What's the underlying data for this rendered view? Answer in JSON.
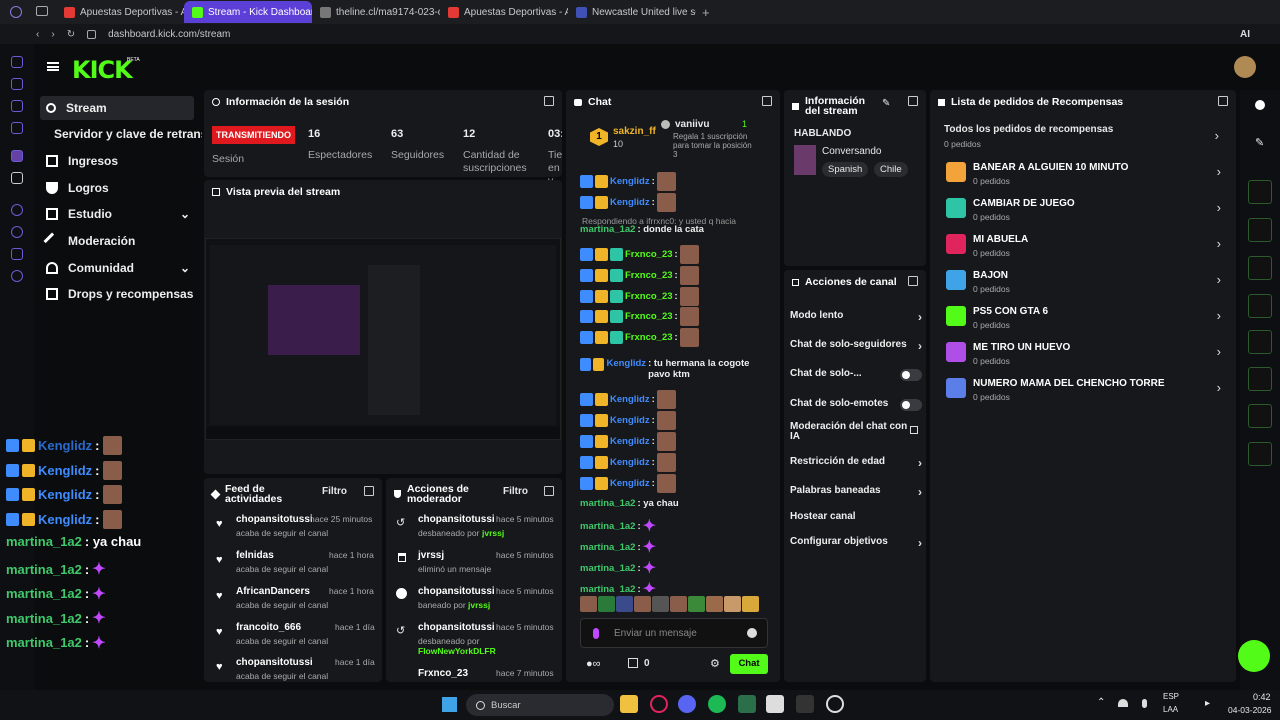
{
  "browser": {
    "tabs": [
      {
        "label": "Apuestas Deportivas - Ap",
        "color": "#e53935"
      },
      {
        "label": "Stream - Kick Dashboard",
        "color": "#53fc18"
      },
      {
        "label": "theline.cl/ma9174-023-os",
        "color": "#999999"
      },
      {
        "label": "Apuestas Deportivas - Ap",
        "color": "#e53935"
      },
      {
        "label": "Newcastle United live scor",
        "color": "#3f51b5"
      }
    ],
    "url": "dashboard.kick.com/stream",
    "ai_label": "AI"
  },
  "brand": {
    "logo": "KICK",
    "beta": "BETA",
    "accent": "#53fc18"
  },
  "nav": [
    {
      "label": "Stream",
      "icon": "broadcast-icon"
    },
    {
      "label": "Servidor y clave de retransmisión",
      "icon": ""
    },
    {
      "label": "Ingresos",
      "icon": "revenue-icon"
    },
    {
      "label": "Logros",
      "icon": "trophy-icon"
    },
    {
      "label": "Estudio",
      "icon": "studio-icon"
    },
    {
      "label": "Moderación",
      "icon": "wrench-icon"
    },
    {
      "label": "Comunidad",
      "icon": "community-icon"
    },
    {
      "label": "Drops y recompensas",
      "icon": "drops-icon"
    }
  ],
  "session": {
    "title": "Información de la sesión",
    "status": "TRANSMITIENDO",
    "session_label": "Sesión",
    "stats": [
      {
        "value": "16",
        "label": "Espectadores"
      },
      {
        "value": "63",
        "label": "Seguidores"
      },
      {
        "value": "12",
        "label": "Cantidad de suscripciones"
      },
      {
        "value": "03:",
        "label": "Tie en v"
      }
    ]
  },
  "preview": {
    "title": "Vista previa del stream"
  },
  "feed": {
    "title": "Feed de actividades",
    "filter": "Filtro",
    "items": [
      {
        "user": "chopansitotussi",
        "time": "hace 25 minutos",
        "text": "acaba de seguir el canal"
      },
      {
        "user": "felnidas",
        "time": "hace 1 hora",
        "text": "acaba de seguir el canal"
      },
      {
        "user": "AfricanDancers",
        "time": "hace 1 hora",
        "text": "acaba de seguir el canal"
      },
      {
        "user": "francoito_666",
        "time": "hace 1 día",
        "text": "acaba de seguir el canal"
      },
      {
        "user": "chopansitotussi",
        "time": "hace 1 día",
        "text": "acaba de seguir el canal"
      }
    ]
  },
  "modactions": {
    "title": "Acciones de moderador",
    "filter": "Filtro",
    "items": [
      {
        "user": "chopansitotussi",
        "time": "hace 5 minutos",
        "text": "desbaneado por",
        "by": "jvrssj"
      },
      {
        "user": "jvrssj",
        "time": "hace 5 minutos",
        "text": "eliminó un mensaje",
        "by": ""
      },
      {
        "user": "chopansitotussi",
        "time": "hace 5 minutos",
        "text": "baneado por",
        "by": "jvrssj"
      },
      {
        "user": "chopansitotussi",
        "time": "hace 5 minutos",
        "text": "desbaneado por",
        "by": "FlowNewYorkDLFR"
      },
      {
        "user": "Frxnco_23",
        "time": "hace 7 minutos",
        "text": "",
        "by": ""
      }
    ]
  },
  "chat": {
    "title": "Chat",
    "pinned": {
      "user": "sakzin_ff",
      "count": "10",
      "rank": "1"
    },
    "gift": {
      "user": "vaniivu",
      "count": "1",
      "text": "Regala 1 suscripción para tomar la posición 3"
    },
    "reply_note": "Respondiendo a ifrrxnc0: y usted q hacia",
    "messages": [
      {
        "user": "Kenglidz",
        "text": ":",
        "color": "#3f8cff"
      },
      {
        "user": "Kenglidz",
        "text": ":",
        "color": "#3f8cff"
      },
      {
        "user": "martina_1a2",
        "text": ": donde la cata",
        "color": "#3fc96b"
      },
      {
        "user": "Frxnco_23",
        "text": ":",
        "color": "#53fc18"
      },
      {
        "user": "Frxnco_23",
        "text": ":",
        "color": "#53fc18"
      },
      {
        "user": "Frxnco_23",
        "text": ":",
        "color": "#53fc18"
      },
      {
        "user": "Frxnco_23",
        "text": ":",
        "color": "#53fc18"
      },
      {
        "user": "Frxnco_23",
        "text": ":",
        "color": "#53fc18"
      },
      {
        "user": "Kenglidz",
        "text": ": tu hermana la cogote pavo ktm",
        "color": "#3f8cff"
      },
      {
        "user": "Kenglidz",
        "text": ":",
        "color": "#3f8cff"
      },
      {
        "user": "Kenglidz",
        "text": ":",
        "color": "#3f8cff"
      },
      {
        "user": "Kenglidz",
        "text": ":",
        "color": "#3f8cff"
      },
      {
        "user": "Kenglidz",
        "text": ":",
        "color": "#3f8cff"
      },
      {
        "user": "Kenglidz",
        "text": ":",
        "color": "#3f8cff"
      },
      {
        "user": "martina_1a2",
        "text": ": ya chau",
        "color": "#3fc96b"
      },
      {
        "user": "martina_1a2",
        "text": ":",
        "color": "#3fc96b"
      },
      {
        "user": "martina_1a2",
        "text": ":",
        "color": "#3fc96b"
      },
      {
        "user": "martina_1a2",
        "text": ":",
        "color": "#3fc96b"
      },
      {
        "user": "martina_1a2",
        "text": ":",
        "color": "#3fc96b"
      }
    ],
    "placeholder": "Enviar un mensaje",
    "points": "0",
    "send": "Chat"
  },
  "streaminfo": {
    "title": "Información del stream",
    "status": "HABLANDO",
    "category": "Conversando",
    "tags": [
      "Spanish",
      "Chile"
    ]
  },
  "channel": {
    "title": "Acciones de canal",
    "items": [
      {
        "label": "Modo lento",
        "type": "chevron"
      },
      {
        "label": "Chat de solo-seguidores",
        "type": "chevron"
      },
      {
        "label": "Chat de solo-...",
        "type": "toggle"
      },
      {
        "label": "Chat de solo-emotes",
        "type": "toggle"
      },
      {
        "label": "Moderación del chat con IA",
        "type": "external"
      },
      {
        "label": "Restricción de edad",
        "type": "chevron"
      },
      {
        "label": "Palabras baneadas",
        "type": "chevron"
      },
      {
        "label": "Hostear canal",
        "type": "none"
      },
      {
        "label": "Configurar objetivos",
        "type": "chevron"
      }
    ]
  },
  "rewards": {
    "title": "Lista de pedidos de Recompensas",
    "items": [
      {
        "name": "Todos los pedidos de recompensas",
        "count": "0 pedidos",
        "color": ""
      },
      {
        "name": "BANEAR A ALGUIEN 10 MINUTO",
        "count": "0 pedidos",
        "color": "#f2a33a"
      },
      {
        "name": "CAMBIAR DE JUEGO",
        "count": "0 pedidos",
        "color": "#2ec4a6"
      },
      {
        "name": "MI ABUELA",
        "count": "0 pedidos",
        "color": "#e0245e"
      },
      {
        "name": "BAJON",
        "count": "0 pedidos",
        "color": "#3fa3e8"
      },
      {
        "name": "PS5 CON GTA 6",
        "count": "0 pedidos",
        "color": "#53fc18"
      },
      {
        "name": "ME TIRO UN HUEVO",
        "count": "0 pedidos",
        "color": "#b04ee8"
      },
      {
        "name": "NUMERO MAMA DEL CHENCHO TORRE",
        "count": "0 pedidos",
        "color": "#5c7ee8"
      }
    ]
  },
  "overlay": [
    {
      "user": "Kenglidz",
      "text": ":"
    },
    {
      "user": "Kenglidz",
      "text": ":"
    },
    {
      "user": "Kenglidz",
      "text": ":"
    },
    {
      "user": "Kenglidz",
      "text": ":"
    },
    {
      "user": "martina_1a2",
      "text": ": ya chau"
    },
    {
      "user": "martina_1a2",
      "text": ":"
    },
    {
      "user": "martina_1a2",
      "text": ":"
    },
    {
      "user": "martina_1a2",
      "text": ":"
    },
    {
      "user": "martina_1a2",
      "text": ":"
    }
  ],
  "taskbar": {
    "search": "Buscar",
    "lang": "ESP",
    "lang2": "LAA",
    "time": "0:42",
    "date": "04-03-2026"
  }
}
